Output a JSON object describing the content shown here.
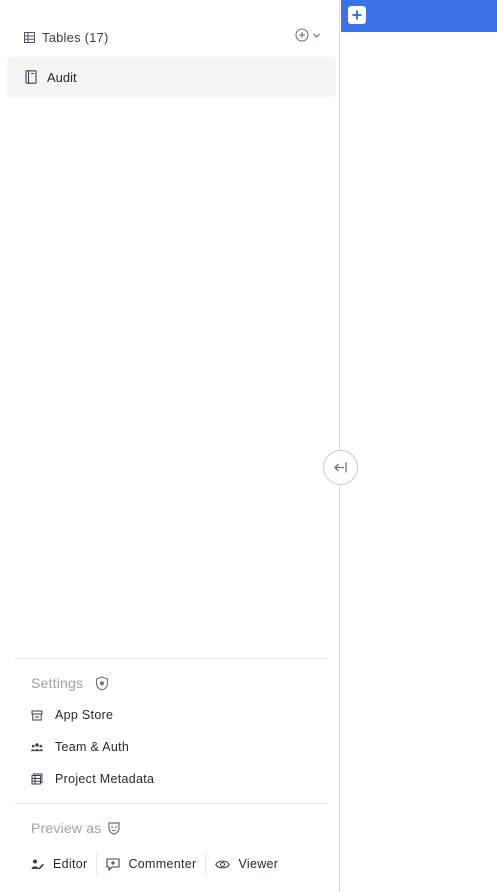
{
  "sidebar": {
    "tables_header": {
      "label": "Tables (17)",
      "icon": "grid-icon"
    },
    "tables": [
      {
        "label": "Audit",
        "icon": "book-icon",
        "selected": true
      }
    ],
    "settings": {
      "title": "Settings",
      "items": [
        {
          "label": "App Store",
          "icon": "store-icon"
        },
        {
          "label": "Team & Auth",
          "icon": "users-icon"
        },
        {
          "label": "Project Metadata",
          "icon": "metadata-icon"
        }
      ]
    },
    "preview": {
      "title": "Preview as",
      "options": [
        {
          "label": "Editor",
          "icon": "editor-icon"
        },
        {
          "label": "Commenter",
          "icon": "comment-icon"
        },
        {
          "label": "Viewer",
          "icon": "eye-icon"
        }
      ]
    }
  },
  "colors": {
    "accent": "#3a72e8",
    "selected_bg": "#f4f4f5",
    "muted_text": "#9ca3af"
  }
}
